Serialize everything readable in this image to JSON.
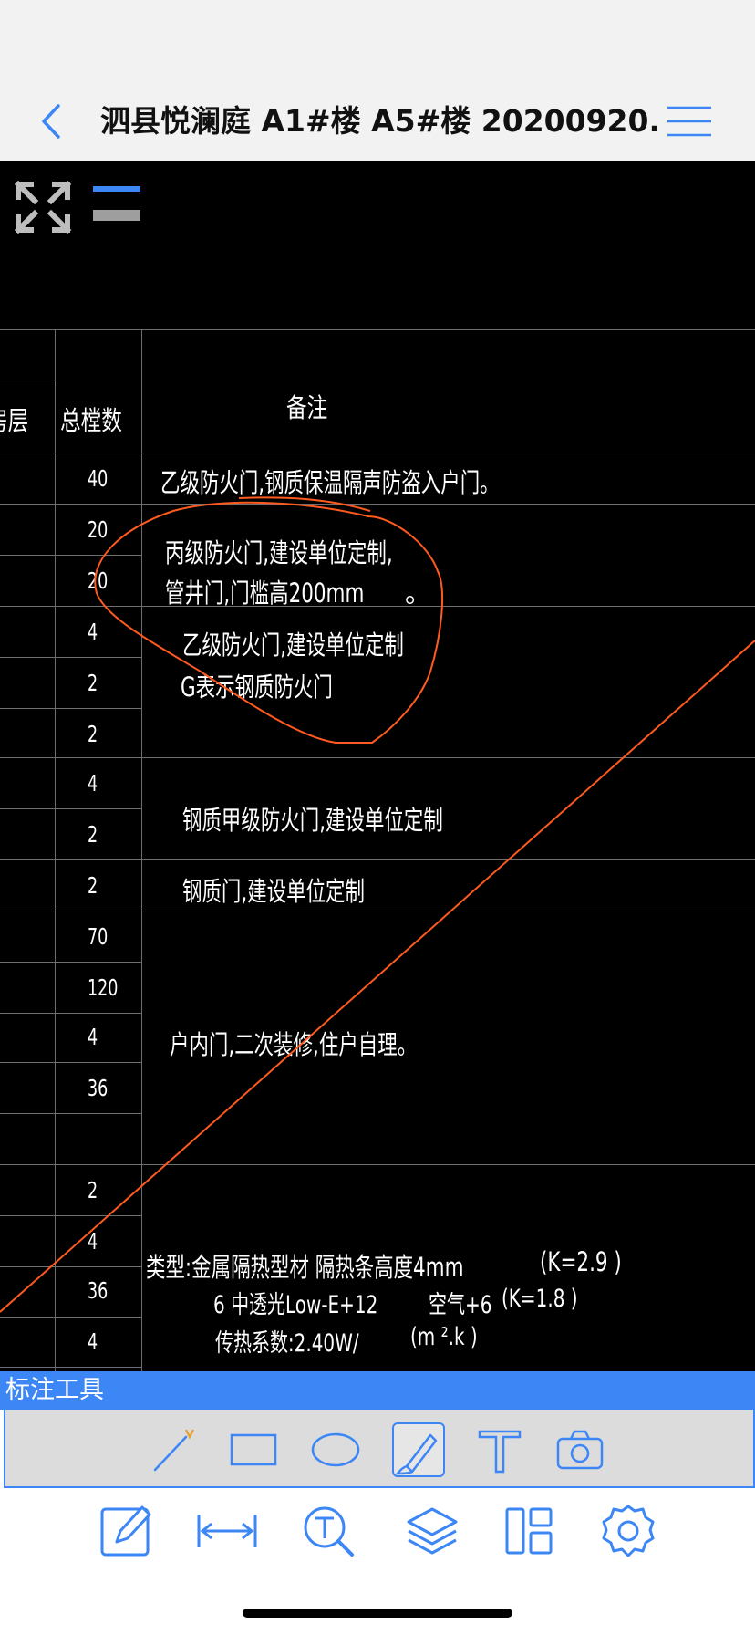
{
  "header": {
    "title": "泗县悦澜庭 A1#楼 A5#楼 20200920...",
    "back_icon": "chevron-left-icon",
    "menu_icon": "hamburger-menu-icon"
  },
  "canvas": {
    "view_tools": {
      "expand_icon": "fullscreen-expand-icon",
      "layers_icon": "layer-toggle-icon"
    },
    "table": {
      "partial_header": "房层",
      "count_header": "总樘数",
      "remark_header": "备注",
      "counts": [
        "40",
        "20",
        "20",
        "4",
        "2",
        "2",
        "4",
        "2",
        "2",
        "70",
        "120",
        "4",
        "36",
        "",
        "2",
        "4",
        "36",
        "4"
      ],
      "remarks": {
        "r1": "乙级防火门,钢质保温隔声防盗入户门。",
        "r2a": "丙级防火门,建设单位定制,",
        "r2b": "管井门,门槛高200mm",
        "r2c": "。",
        "r3a": "乙级防火门,建设单位定制",
        "r3b": "G表示钢质防火门",
        "r4": "钢质甲级防火门,建设单位定制",
        "r5": "钢质门,建设单位定制",
        "r6": "户内门,二次装修,住户自理。",
        "r7a": "类型:金属隔热型材  隔热条高度4mm",
        "r7a_k": "(K=2.9  )",
        "r7b": "6 中透光Low-E+12",
        "r7b_air": "空气+6",
        "r7b_k": "(K=1.8  )",
        "r7c": "传热系数:2.40W/",
        "r7c_unit": "(m ².k )"
      }
    },
    "markup_color": "#ff5a1f"
  },
  "annotation_tools": {
    "label": "标注工具",
    "tools": [
      {
        "name": "line-tool",
        "icon": "pen-line-icon"
      },
      {
        "name": "rectangle-tool",
        "icon": "rectangle-icon"
      },
      {
        "name": "ellipse-tool",
        "icon": "ellipse-icon"
      },
      {
        "name": "freehand-tool",
        "icon": "brush-icon",
        "selected": true
      },
      {
        "name": "text-tool",
        "icon": "text-t-icon"
      },
      {
        "name": "camera-tool",
        "icon": "camera-icon"
      }
    ]
  },
  "bottom_toolbar": {
    "items": [
      {
        "name": "annotate",
        "icon": "edit-note-icon"
      },
      {
        "name": "measure",
        "icon": "measure-distance-icon"
      },
      {
        "name": "text-search",
        "icon": "text-search-icon"
      },
      {
        "name": "layers",
        "icon": "layers-icon"
      },
      {
        "name": "layout",
        "icon": "layout-icon"
      },
      {
        "name": "settings",
        "icon": "gear-icon"
      }
    ]
  },
  "colors": {
    "accent": "#3c86f5",
    "background": "#000000",
    "header_bg": "#f2f2f2"
  }
}
